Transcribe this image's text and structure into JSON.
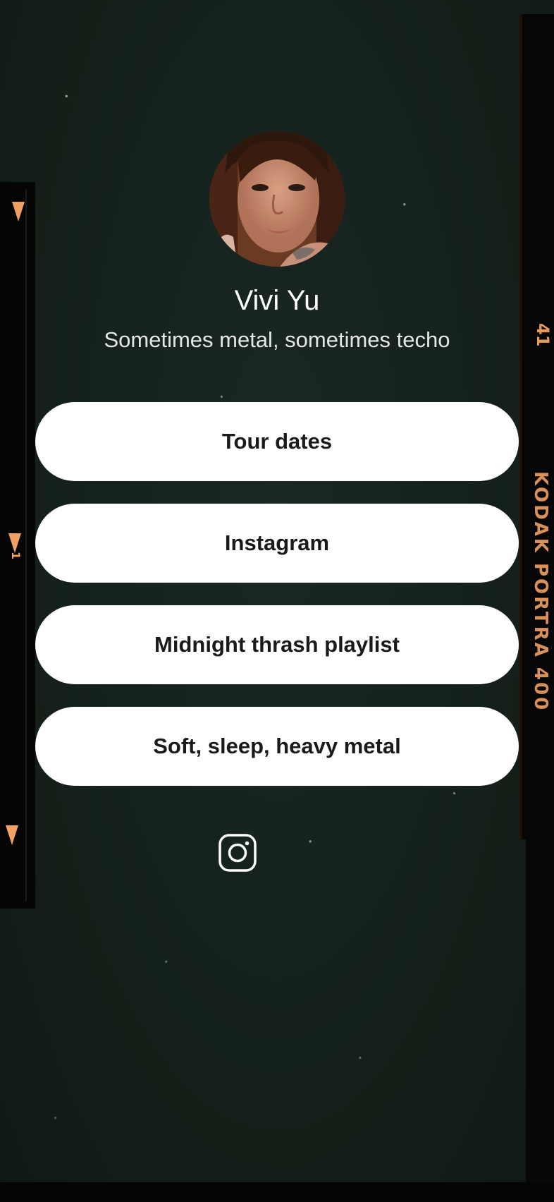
{
  "profile": {
    "name": "Vivi Yu",
    "bio": "Sometimes metal, sometimes techo",
    "avatar_alt": "profile-photo"
  },
  "links": [
    {
      "label": "Tour dates"
    },
    {
      "label": "Instagram"
    },
    {
      "label": "Midnight thrash playlist"
    },
    {
      "label": "Soft, sleep, heavy metal"
    }
  ],
  "social": {
    "icon": "instagram-icon"
  },
  "film": {
    "brand_text": "KODAK PORTRA 400",
    "frame_number": "41",
    "frame_marker": "1",
    "accent_color": "#f0a062"
  },
  "colors": {
    "background": "#172220",
    "button_bg": "#ffffff",
    "button_text": "#1a1a1a",
    "text": "#ffffff"
  }
}
